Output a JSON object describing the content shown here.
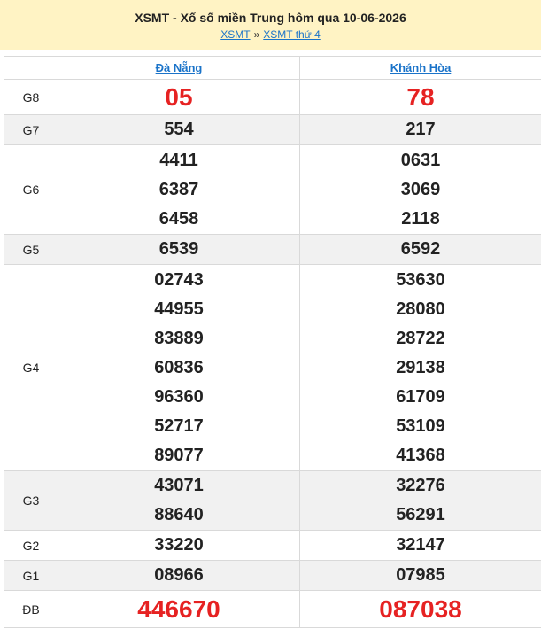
{
  "header": {
    "title": "XSMT - Xổ số miền Trung hôm qua 10-06-2026",
    "crumb_1": "XSMT",
    "crumb_sep": "»",
    "crumb_2": "XSMT thứ 4"
  },
  "provinces": [
    "Đà Nẵng",
    "Khánh Hòa"
  ],
  "prizes": {
    "G8": {
      "label": "G8",
      "da_nang": [
        "05"
      ],
      "khanh_hoa": [
        "78"
      ]
    },
    "G7": {
      "label": "G7",
      "da_nang": [
        "554"
      ],
      "khanh_hoa": [
        "217"
      ]
    },
    "G6": {
      "label": "G6",
      "da_nang": [
        "4411",
        "6387",
        "6458"
      ],
      "khanh_hoa": [
        "0631",
        "3069",
        "2118"
      ]
    },
    "G5": {
      "label": "G5",
      "da_nang": [
        "6539"
      ],
      "khanh_hoa": [
        "6592"
      ]
    },
    "G4": {
      "label": "G4",
      "da_nang": [
        "02743",
        "44955",
        "83889",
        "60836",
        "96360",
        "52717",
        "89077"
      ],
      "khanh_hoa": [
        "53630",
        "28080",
        "28722",
        "29138",
        "61709",
        "53109",
        "41368"
      ]
    },
    "G3": {
      "label": "G3",
      "da_nang": [
        "43071",
        "88640"
      ],
      "khanh_hoa": [
        "32276",
        "56291"
      ]
    },
    "G2": {
      "label": "G2",
      "da_nang": [
        "33220"
      ],
      "khanh_hoa": [
        "32147"
      ]
    },
    "G1": {
      "label": "G1",
      "da_nang": [
        "08966"
      ],
      "khanh_hoa": [
        "07985"
      ]
    },
    "DB": {
      "label": "ĐB",
      "da_nang": [
        "446670"
      ],
      "khanh_hoa": [
        "087038"
      ]
    }
  },
  "colors": {
    "header_bg": "#fff3c4",
    "link": "#1a73c9",
    "highlight": "#e62222",
    "alt_row": "#f1f1f1"
  }
}
